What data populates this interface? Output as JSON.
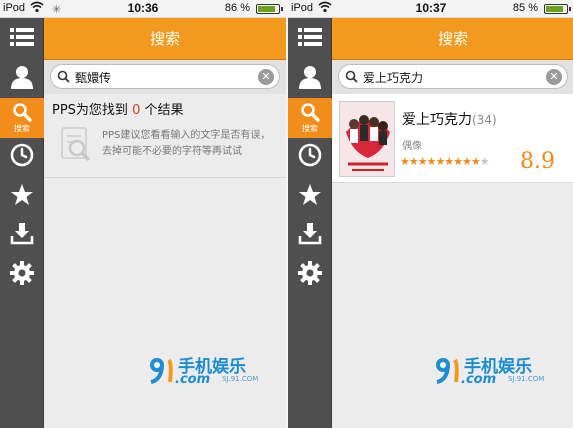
{
  "colors": {
    "accent": "#f39a1e",
    "sidebar": "#4f4f4f",
    "active_nav": "#f28c1a",
    "highlight_red": "#e23a1a",
    "watermark_blue": "#1d8cd0"
  },
  "left_phone": {
    "status_bar": {
      "carrier": "iPod",
      "time": "10:36",
      "battery": "86 %",
      "battery_level": 0.86
    },
    "sidebar": {
      "icons": [
        "list-icon",
        "user-icon",
        "search-icon",
        "clock-icon",
        "star-icon",
        "download-icon",
        "gear-icon"
      ],
      "active_label": "搜索"
    },
    "header_title": "搜索",
    "search": {
      "value": "甄嬛传"
    },
    "result": {
      "prefix": "PPS为您找到",
      "count": "0",
      "suffix": "个结果"
    },
    "suggestion": "PPS建议您看看输入的文字是否有误，去掉可能不必要的字符等再试试"
  },
  "right_phone": {
    "status_bar": {
      "carrier": "iPod",
      "time": "10:37",
      "battery": "85 %",
      "battery_level": 0.85
    },
    "sidebar": {
      "icons": [
        "list-icon",
        "user-icon",
        "search-icon",
        "clock-icon",
        "star-icon",
        "download-icon",
        "gear-icon"
      ],
      "active_label": "搜索"
    },
    "header_title": "搜索",
    "search": {
      "value": "爱上巧克力"
    },
    "results": [
      {
        "title": "爱上巧克力",
        "count": "(34)",
        "genre": "偶像",
        "rating": 8.9,
        "stars_filled": "★★★★★★★★★",
        "stars_empty": "★",
        "score": "8.9"
      }
    ]
  },
  "watermark": {
    "brand": "手机娱乐",
    "com": ".com",
    "url": "SJ.91.COM"
  }
}
